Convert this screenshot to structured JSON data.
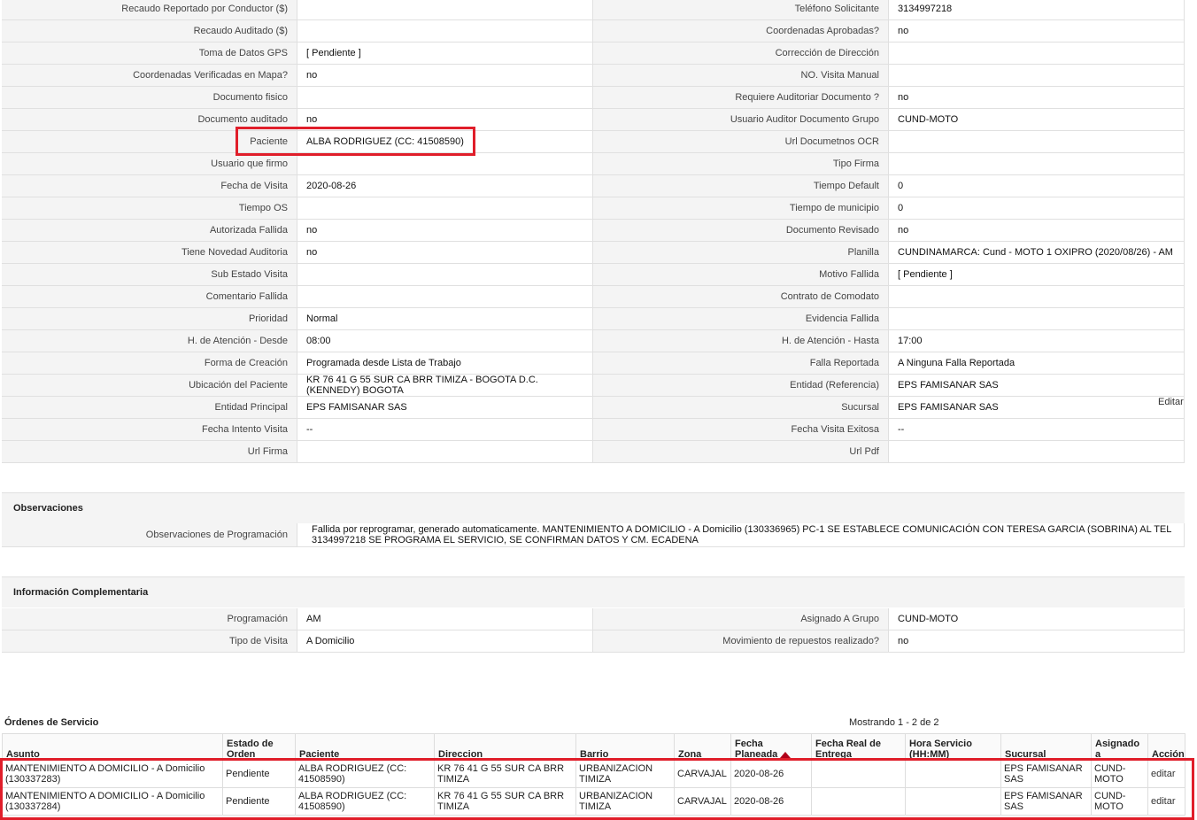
{
  "details": [
    {
      "l1": "Recaudo Reportado por Conductor ($)",
      "v1": "",
      "l2": "Teléfono Solicitante",
      "v2": "3134997218"
    },
    {
      "l1": "Recaudo Auditado ($)",
      "v1": "",
      "l2": "Coordenadas Aprobadas?",
      "v2": " no"
    },
    {
      "l1": "Toma de Datos GPS",
      "v1": "[ Pendiente ]",
      "l2": "Corrección de Dirección",
      "v2": ""
    },
    {
      "l1": "Coordenadas Verificadas en Mapa?",
      "v1": " no",
      "l2": "NO. Visita Manual",
      "v2": ""
    },
    {
      "l1": "Documento fisico",
      "v1": "",
      "l2": "Requiere Auditoriar Documento ?",
      "v2": " no"
    },
    {
      "l1": "Documento auditado",
      "v1": " no",
      "l2": "Usuario Auditor Documento Grupo",
      "v2": "CUND-MOTO"
    },
    {
      "l1": "Paciente",
      "v1": "ALBA RODRIGUEZ (CC: 41508590)",
      "l2": "Url Documetnos OCR",
      "v2": ""
    },
    {
      "l1": "Usuario que firmo",
      "v1": "",
      "l2": "Tipo Firma",
      "v2": ""
    },
    {
      "l1": "Fecha de Visita",
      "v1": " 2020-08-26",
      "l2": "Tiempo Default",
      "v2": "0"
    },
    {
      "l1": "Tiempo OS",
      "v1": "",
      "l2": "Tiempo de municipio",
      "v2": "0"
    },
    {
      "l1": "Autorizada Fallida",
      "v1": " no",
      "l2": "Documento Revisado",
      "v2": " no"
    },
    {
      "l1": "Tiene Novedad Auditoria",
      "v1": " no",
      "l2": "Planilla",
      "v2": "CUNDINAMARCA: Cund - MOTO 1 OXIPRO (2020/08/26) - AM"
    },
    {
      "l1": "Sub Estado Visita",
      "v1": "",
      "l2": "Motivo Fallida",
      "v2": "[ Pendiente ]"
    },
    {
      "l1": "Comentario Fallida",
      "v1": "",
      "l2": "Contrato de Comodato",
      "v2": ""
    },
    {
      "l1": "Prioridad",
      "v1": "Normal",
      "l2": "Evidencia Fallida",
      "v2": ""
    },
    {
      "l1": "H. de Atención - Desde",
      "v1": "08:00",
      "l2": "H. de Atención - Hasta",
      "v2": "17:00"
    },
    {
      "l1": "Forma de Creación",
      "v1": "Programada desde Lista de Trabajo",
      "l2": "Falla Reportada",
      "v2": "A Ninguna Falla Reportada"
    },
    {
      "l1": "Ubicación del Paciente",
      "v1": "KR 76 41 G 55 SUR CA BRR TIMIZA - BOGOTA D.C. (KENNEDY) BOGOTA",
      "l2": "Entidad (Referencia)",
      "v2": "EPS FAMISANAR SAS"
    },
    {
      "l1": "Entidad Principal",
      "v1": "EPS FAMISANAR SAS",
      "l2": "Sucursal",
      "v2": "EPS FAMISANAR SAS"
    },
    {
      "l1": "Fecha Intento Visita",
      "v1": " --",
      "l2": "Fecha Visita Exitosa",
      "v2": " --"
    },
    {
      "l1": "Url Firma",
      "v1": "",
      "l2": "Url Pdf",
      "v2": ""
    }
  ],
  "edit_link": "Editar",
  "observaciones": {
    "title": "Observaciones",
    "label": "Observaciones de Programación",
    "value": "Fallida por reprogramar, generado automaticamente. MANTENIMIENTO A DOMICILIO - A Domicilio (130336965) PC-1 SE ESTABLECE COMUNICACIÓN CON TERESA GARCIA (SOBRINA) AL TEL 3134997218 SE PROGRAMA EL SERVICIO, SE CONFIRMAN DATOS Y CM. ECADENA"
  },
  "complementaria": {
    "title": "Información Complementaria",
    "rows": [
      {
        "l1": "Programación",
        "v1": "AM",
        "l2": "Asignado A Grupo",
        "v2": "CUND-MOTO"
      },
      {
        "l1": "Tipo de Visita",
        "v1": "A Domicilio",
        "l2": "Movimiento de repuestos realizado?",
        "v2": " no"
      }
    ]
  },
  "orders": {
    "title": "Órdenes de Servicio",
    "showing": "Mostrando 1 - 2 de 2",
    "columns": [
      "Asunto",
      "Estado de Orden",
      "Paciente",
      "Direccion",
      "Barrio",
      "Zona",
      "Fecha Planeada",
      "Fecha Real de Entrega",
      "Hora Servicio (HH:MM)",
      "Sucursal",
      "Asignado a",
      "Acción"
    ],
    "rows": [
      [
        "MANTENIMIENTO A DOMICILIO - A Domicilio (130337283)",
        "Pendiente",
        "ALBA RODRIGUEZ (CC: 41508590)",
        "KR 76 41 G 55 SUR CA BRR TIMIZA",
        "URBANIZACION TIMIZA",
        "CARVAJAL",
        "2020-08-26",
        "",
        "",
        "EPS FAMISANAR SAS",
        "CUND-MOTO",
        "editar"
      ],
      [
        "MANTENIMIENTO A DOMICILIO - A Domicilio (130337284)",
        "Pendiente",
        "ALBA RODRIGUEZ (CC: 41508590)",
        "KR 76 41 G 55 SUR CA BRR TIMIZA",
        "URBANIZACION TIMIZA",
        "CARVAJAL",
        "2020-08-26",
        "",
        "",
        "EPS FAMISANAR SAS",
        "CUND-MOTO",
        "editar"
      ]
    ]
  }
}
